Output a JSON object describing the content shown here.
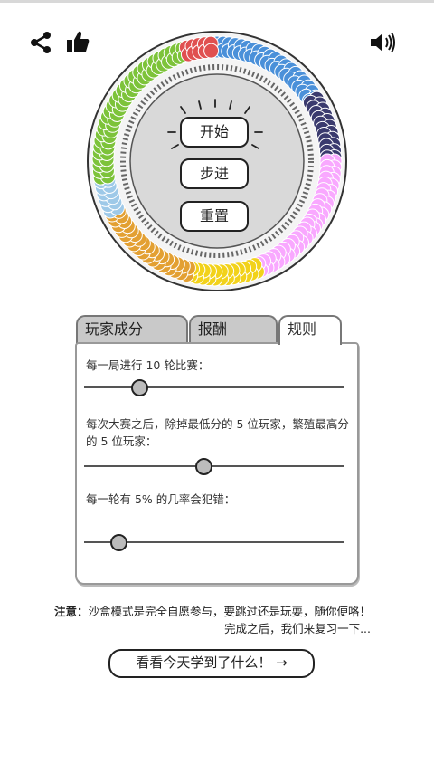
{
  "toolbar": {
    "share_icon": "share-icon",
    "like_icon": "thumbs-up-icon",
    "sound_icon": "speaker-icon"
  },
  "sim": {
    "start_label": "开始",
    "step_label": "步进",
    "reset_label": "重置",
    "segment_colors": [
      "#4a90d9",
      "#7dc33a",
      "#e05050",
      "#f9a8ff",
      "#f2d21a",
      "#e3a032",
      "#3a3a6e",
      "#9ec9e8"
    ]
  },
  "tabs": [
    {
      "label": "玩家成分",
      "active": false
    },
    {
      "label": "报酬",
      "active": false
    },
    {
      "label": "规则",
      "active": true
    }
  ],
  "rules": {
    "rounds_text": "每一局进行 10 轮比赛：",
    "rounds_value": 10,
    "evolve_text": "每次大赛之后，除掉最低分的 5 位玩家，繁殖最高分的 5 位玩家：",
    "evolve_value": 5,
    "noise_text": "每一轮有 5% 的几率会犯错：",
    "noise_value": 5
  },
  "note": {
    "prefix": "注意：",
    "text": "沙盒模式是完全自愿参与，要跳过还是玩耍，随你便咯！完成之后，我们来复习一下..."
  },
  "next_button": "看看今天学到了什么！ →"
}
